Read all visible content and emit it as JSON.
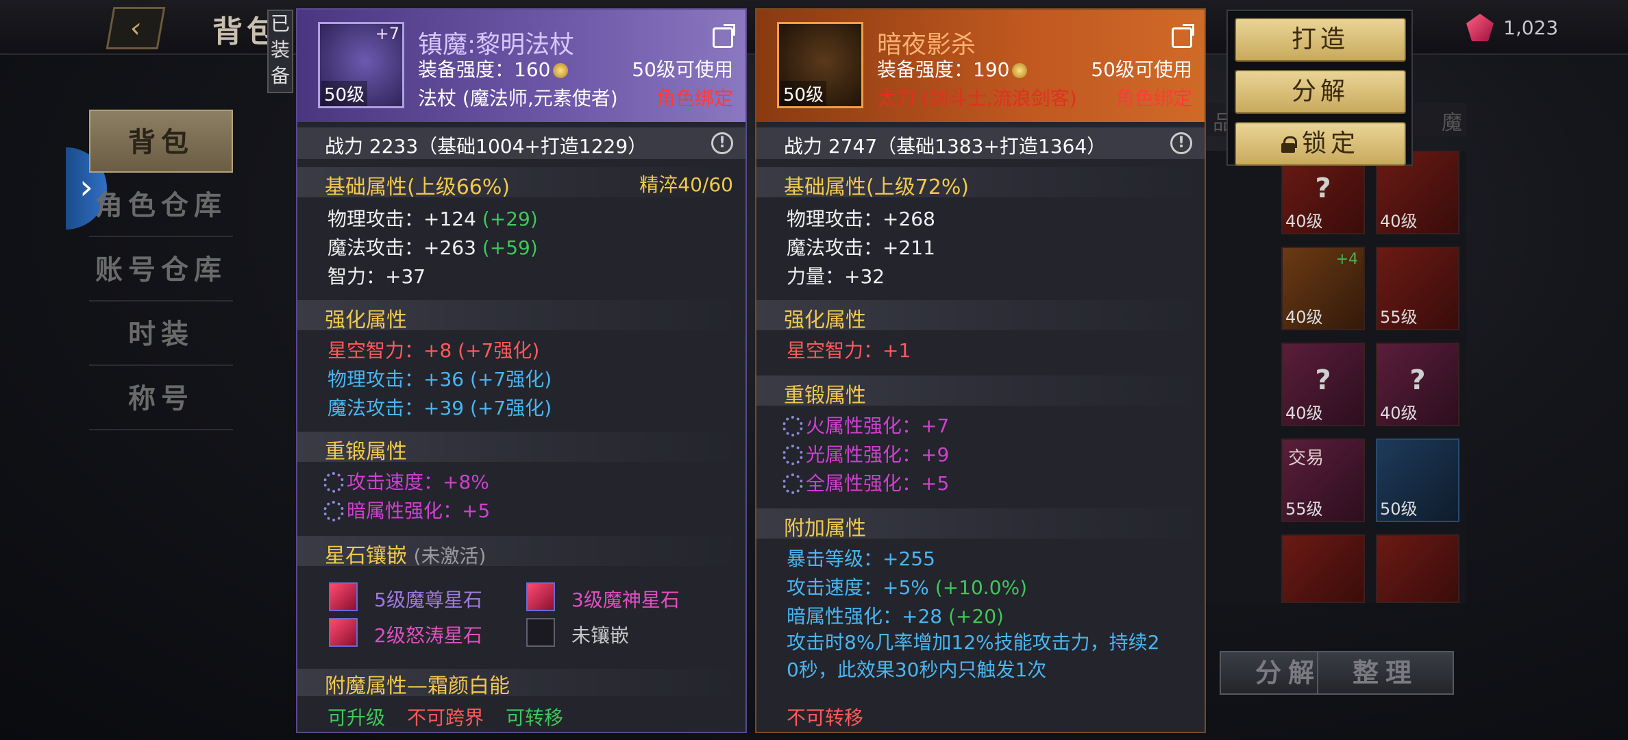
{
  "top": {
    "title": "背包",
    "currency_value": "1,023"
  },
  "side_menu": [
    "背包",
    "角色仓库",
    "账号仓库",
    "时装",
    "称号"
  ],
  "equipped_badge": [
    "已",
    "装",
    "备"
  ],
  "inventory": {
    "header_left": "品",
    "header_right": "魔",
    "cells": [
      {
        "level": "40级",
        "unknown": "?",
        "color": "red"
      },
      {
        "level": "40级",
        "unknown": "",
        "color": "red"
      },
      {
        "level": "40级",
        "unknown": "",
        "plus": "+4",
        "color": "red"
      },
      {
        "level": "55级",
        "unknown": "",
        "color": "red"
      },
      {
        "level": "40级",
        "unknown": "?",
        "color": "pink"
      },
      {
        "level": "40级",
        "unknown": "?",
        "color": "pink"
      },
      {
        "level": "55级",
        "unknown": "",
        "tag": "交易",
        "color": "pink"
      },
      {
        "level": "50级",
        "unknown": "",
        "color": "blue"
      }
    ],
    "bottom_buttons": [
      "分解",
      "整理"
    ]
  },
  "actions": {
    "forge": "打造",
    "dismantle": "分解",
    "lock": "锁定"
  },
  "left_item": {
    "name": "镇魔:黎明法杖",
    "enhance": "+7",
    "icon_level": "50级",
    "strength_label": "装备强度：160",
    "usable": "50级可使用",
    "weapon_class": "法杖 (魔法师,元素使者)",
    "bind": "角色绑定",
    "power": "战力 2233（基础1004+打造1229）",
    "base_title": "基础属性(上级66%)",
    "refine": "精淬40/60",
    "base_rows": [
      {
        "text": "物理攻击：+124",
        "bonus": "(+29)"
      },
      {
        "text": "魔法攻击：+263",
        "bonus": "(+59)"
      },
      {
        "text": "智力：+37",
        "bonus": ""
      }
    ],
    "enh_title": "强化属性",
    "enh_rows": [
      {
        "text": "星空智力：+8 (+7强化)",
        "color": "red"
      },
      {
        "text": "物理攻击：+36 (+7强化)",
        "color": "cyan"
      },
      {
        "text": "魔法攻击：+39 (+7强化)",
        "color": "cyan"
      }
    ],
    "reforge_title": "重锻属性",
    "reforge_rows": [
      "攻击速度：+8%",
      "暗属性强化：+5"
    ],
    "gem_title": "星石镶嵌",
    "gem_sub": "(未激活)",
    "gems": [
      {
        "text": "5级魔尊星石",
        "color": "purple"
      },
      {
        "text": "3级魔神星石",
        "color": "pink"
      },
      {
        "text": "2级怒涛星石",
        "color": "pink"
      },
      {
        "text": "未镶嵌",
        "color": "grey",
        "empty": true
      }
    ],
    "enchant_title": "附魔属性—霜颜白能",
    "footer": [
      {
        "text": "可升级",
        "color": "green"
      },
      {
        "text": "不可跨界",
        "color": "red"
      },
      {
        "text": "可转移",
        "color": "green"
      }
    ]
  },
  "right_item": {
    "name": "暗夜影杀",
    "icon_level": "50级",
    "strength_label": "装备强度：190",
    "usable": "50级可使用",
    "weapon_class": "太刀 (剑斗士,流浪剑客)",
    "bind": "角色绑定",
    "power": "战力 2747（基础1383+打造1364）",
    "base_title": "基础属性(上级72%)",
    "base_rows": [
      "物理攻击：+268",
      "魔法攻击：+211",
      "力量：+32"
    ],
    "enh_title": "强化属性",
    "enh_rows": [
      "星空智力：+1"
    ],
    "reforge_title": "重锻属性",
    "reforge_rows": [
      "火属性强化：+7",
      "光属性强化：+9",
      "全属性强化：+5"
    ],
    "extra_title": "附加属性",
    "extra_rows": [
      {
        "text": "暴击等级：+255",
        "bonus": ""
      },
      {
        "text": "攻击速度：+5%",
        "bonus": "(+10.0%)"
      },
      {
        "text": "暗属性强化：+28",
        "bonus": "(+20)"
      }
    ],
    "desc_line1": "攻击时8%几率增加12%技能攻击力，持续2",
    "desc_line2": "0秒，此效果30秒内只触发1次",
    "footer": "不可转移"
  }
}
